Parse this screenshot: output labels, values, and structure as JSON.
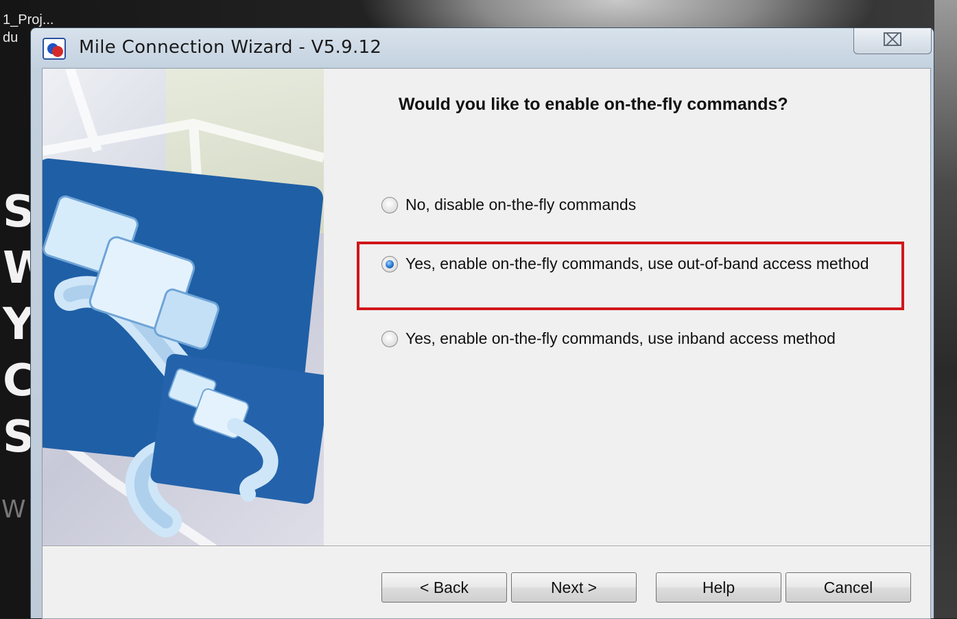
{
  "desktop": {
    "label_top": "1_Proj...",
    "label_second": "du",
    "letters": [
      "S",
      "W",
      "Y",
      "C",
      "S"
    ],
    "small_letter": "W"
  },
  "window": {
    "title": "Mile Connection Wizard - V5.9.12",
    "close_glyph": "⌧",
    "icon": "wizard-app-icon"
  },
  "page": {
    "heading": "Would you like to enable on-the-fly commands?",
    "options": [
      {
        "label": "No, disable on-the-fly commands",
        "selected": false
      },
      {
        "label": "Yes, enable on-the-fly commands, use out-of-band access method",
        "selected": true
      },
      {
        "label": "Yes, enable on-the-fly commands, use inband access method",
        "selected": false
      }
    ],
    "highlight_color": "#d0161a"
  },
  "buttons": {
    "back": "< Back",
    "next": "Next >",
    "help": "Help",
    "cancel": "Cancel"
  }
}
